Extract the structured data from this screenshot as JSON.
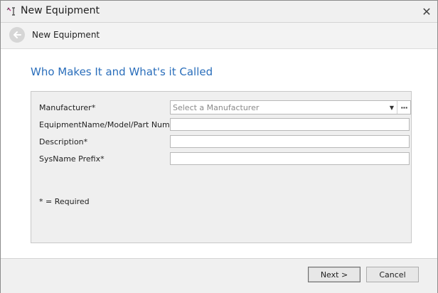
{
  "window": {
    "title": "New Equipment",
    "icon": "equipment-wizard-icon",
    "close_icon": "close-icon"
  },
  "nav": {
    "title": "New Equipment",
    "back_icon": "back-arrow-icon"
  },
  "page": {
    "heading": "Who Makes It and What's it Called"
  },
  "form": {
    "manufacturer": {
      "label": "Manufacturer*",
      "placeholder": "Select a Manufacturer",
      "value": ""
    },
    "equipment_name": {
      "label": "EquipmentName/Model/Part Number*",
      "value": ""
    },
    "description": {
      "label": "Description*",
      "value": ""
    },
    "sysname_prefix": {
      "label": "SysName Prefix*",
      "value": ""
    },
    "required_note": "* = Required"
  },
  "footer": {
    "next_label": "Next >",
    "cancel_label": "Cancel"
  },
  "colors": {
    "heading": "#2a6ebb",
    "panel_bg": "#efefef",
    "chrome_bg": "#f0f0f0"
  }
}
